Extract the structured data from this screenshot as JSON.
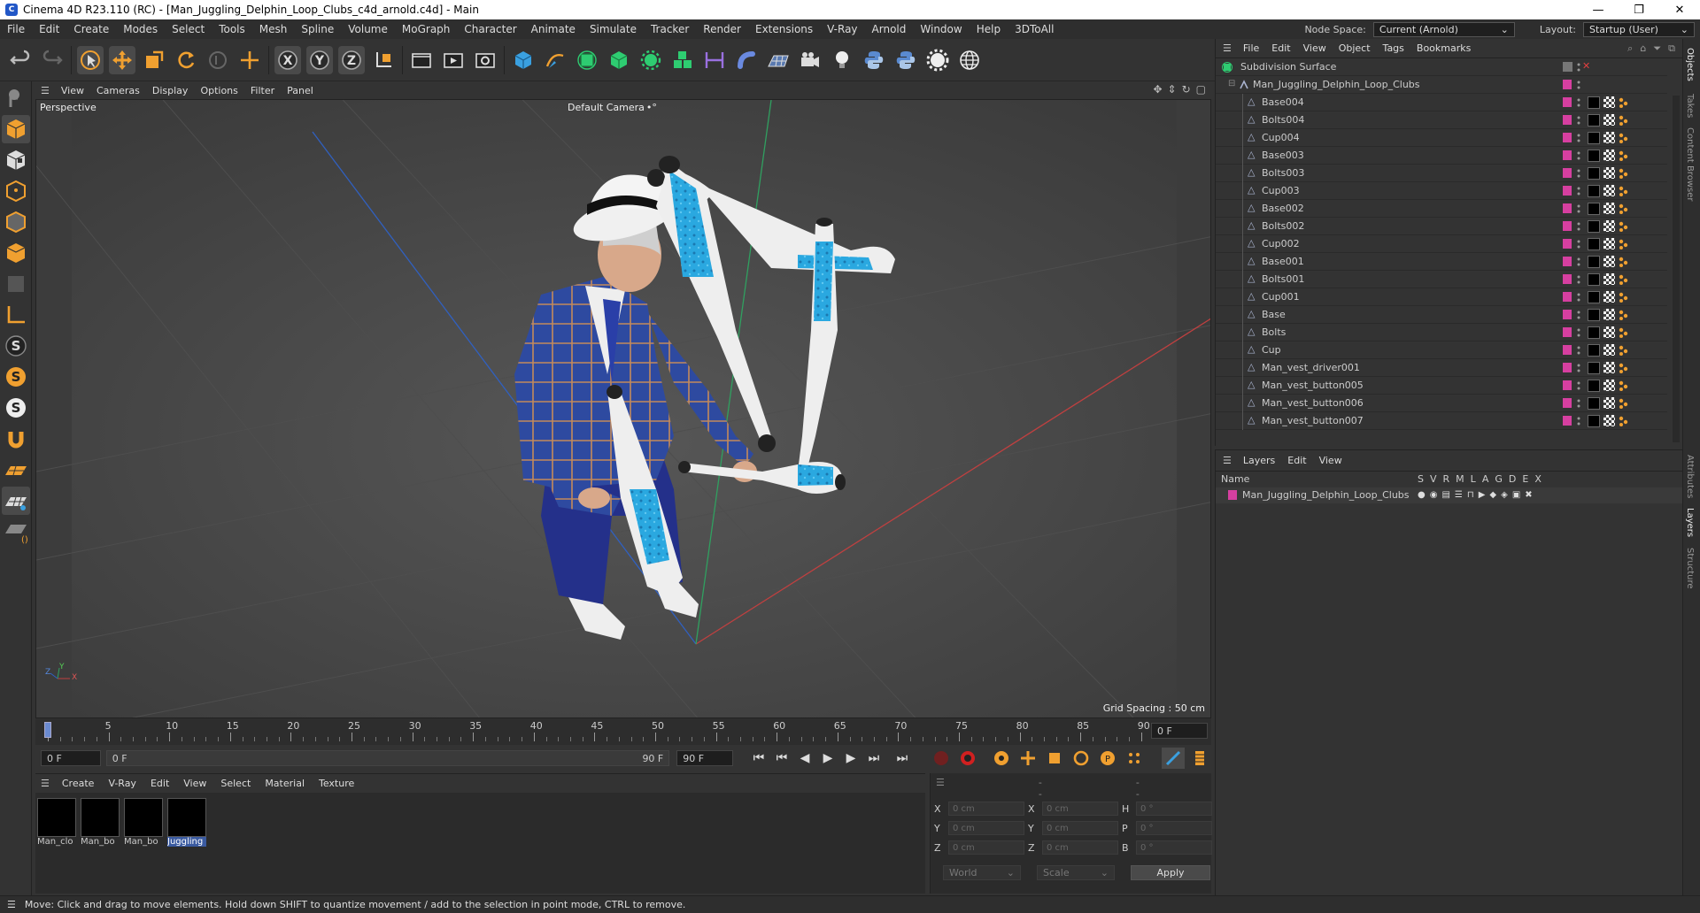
{
  "window": {
    "title": "Cinema 4D R23.110 (RC) - [Man_Juggling_Delphin_Loop_Clubs_c4d_arnold.c4d] - Main",
    "app_icon": "cinema4d-icon",
    "controls": [
      "—",
      "❐",
      "✕"
    ]
  },
  "menubar": {
    "items": [
      "File",
      "Edit",
      "Create",
      "Modes",
      "Select",
      "Tools",
      "Mesh",
      "Spline",
      "Volume",
      "MoGraph",
      "Character",
      "Animate",
      "Simulate",
      "Tracker",
      "Render",
      "Extensions",
      "V-Ray",
      "Arnold",
      "Window",
      "Help",
      "3DToAll"
    ],
    "node_space_label": "Node Space:",
    "node_space_value": "Current (Arnold)",
    "layout_label": "Layout:",
    "layout_value": "Startup (User)"
  },
  "viewport": {
    "menu": [
      "View",
      "Cameras",
      "Display",
      "Options",
      "Filter",
      "Panel"
    ],
    "view_name": "Perspective",
    "camera": "Default Camera",
    "camera_suffix": "•°",
    "grid_spacing": "Grid Spacing : 50 cm",
    "axis": {
      "x": "X",
      "y": "Y",
      "z": "Z"
    }
  },
  "timeline": {
    "ticks": [
      "0",
      "5",
      "10",
      "15",
      "20",
      "25",
      "30",
      "35",
      "40",
      "45",
      "50",
      "55",
      "60",
      "65",
      "70",
      "75",
      "80",
      "85",
      "90"
    ],
    "current_frame": "0 F"
  },
  "playbar": {
    "start": "0 F",
    "range_start": "0 F",
    "range_end": "90 F",
    "end": "90 F"
  },
  "materials": {
    "menu": [
      "Create",
      "V-Ray",
      "Edit",
      "View",
      "Select",
      "Material",
      "Texture"
    ],
    "items": [
      {
        "name": "Man_clo",
        "selected": false
      },
      {
        "name": "Man_bo",
        "selected": false
      },
      {
        "name": "Man_bo",
        "selected": false
      },
      {
        "name": "Juggling",
        "selected": true
      }
    ]
  },
  "coords": {
    "header": [
      "--",
      "--",
      "--"
    ],
    "rows": [
      {
        "l1": "X",
        "v1": "0 cm",
        "l2": "X",
        "v2": "0 cm",
        "l3": "H",
        "v3": "0 °"
      },
      {
        "l1": "Y",
        "v1": "0 cm",
        "l2": "Y",
        "v2": "0 cm",
        "l3": "P",
        "v3": "0 °"
      },
      {
        "l1": "Z",
        "v1": "0 cm",
        "l2": "Z",
        "v2": "0 cm",
        "l3": "B",
        "v3": "0 °"
      }
    ],
    "world": "World",
    "scale": "Scale",
    "apply": "Apply"
  },
  "objects": {
    "menu": [
      "File",
      "Edit",
      "View",
      "Object",
      "Tags",
      "Bookmarks"
    ],
    "root": "Subdivision Surface",
    "group": "Man_Juggling_Delphin_Loop_Clubs",
    "items": [
      "Base004",
      "Bolts004",
      "Cup004",
      "Base003",
      "Bolts003",
      "Cup003",
      "Base002",
      "Bolts002",
      "Cup002",
      "Base001",
      "Bolts001",
      "Cup001",
      "Base",
      "Bolts",
      "Cup",
      "Man_vest_driver001",
      "Man_vest_button005",
      "Man_vest_button006",
      "Man_vest_button007"
    ],
    "accent": "#d63fa0"
  },
  "layers": {
    "menu": [
      "Layers",
      "Edit",
      "View"
    ],
    "name_header": "Name",
    "col_headers": [
      "S",
      "V",
      "R",
      "M",
      "L",
      "A",
      "G",
      "D",
      "E",
      "X"
    ],
    "items": [
      {
        "name": "Man_Juggling_Delphin_Loop_Clubs"
      }
    ]
  },
  "right_tabs": [
    "Objects",
    "Takes",
    "Content Browser",
    "Attributes",
    "Layers",
    "Structure"
  ],
  "status": "Move: Click and drag to move elements. Hold down SHIFT to quantize movement / add to the selection in point mode, CTRL to remove."
}
